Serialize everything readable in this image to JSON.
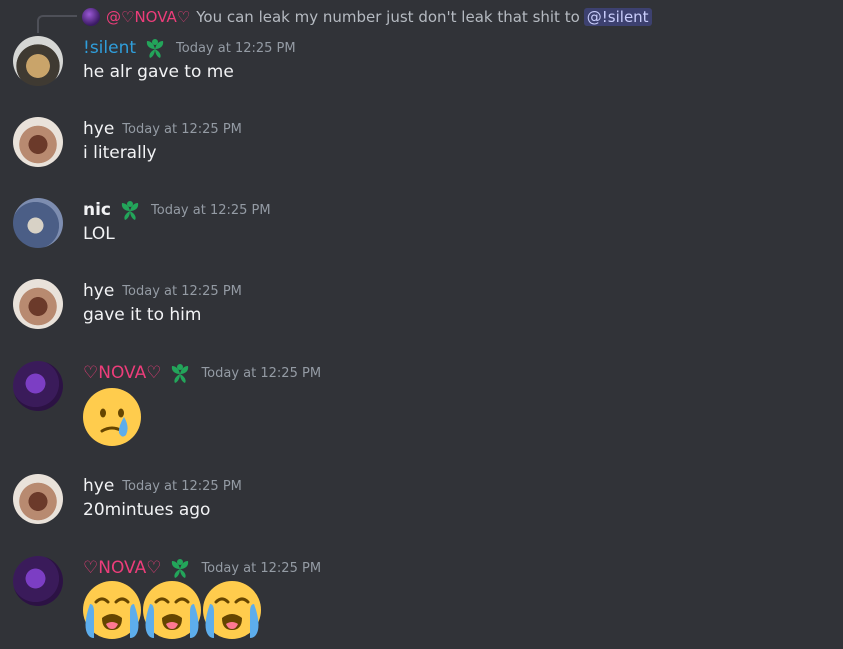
{
  "reply": {
    "author": "@♡NOVA♡",
    "text": "You can leak my number just don't leak that shit to",
    "mention": "@!silent"
  },
  "messages": [
    {
      "author": "!silent",
      "timestamp": "Today at 12:25 PM",
      "text": "he alr gave to me",
      "has_role_icon": true
    },
    {
      "author": "hye",
      "timestamp": "Today at 12:25 PM",
      "text": "i literally",
      "has_role_icon": false
    },
    {
      "author": "nic",
      "timestamp": "Today at 12:25 PM",
      "text": "LOL",
      "has_role_icon": true
    },
    {
      "author": "hye",
      "timestamp": "Today at 12:25 PM",
      "text": "gave it to him",
      "has_role_icon": false
    },
    {
      "author": "♡NOVA♡",
      "timestamp": "Today at 12:25 PM",
      "emojis": [
        "face-holding-back-tears"
      ],
      "has_role_icon": true
    },
    {
      "author": "hye",
      "timestamp": "Today at 12:25 PM",
      "text": "20mintues ago",
      "has_role_icon": false
    },
    {
      "author": "♡NOVA♡",
      "timestamp": "Today at 12:25 PM",
      "emojis": [
        "loudly-crying-face",
        "loudly-crying-face",
        "loudly-crying-face"
      ],
      "has_role_icon": true
    }
  ],
  "colors": {
    "background": "#313338",
    "silent_name": "#2f9edb",
    "nova_name": "#ec3d7a",
    "role_icon": "#23a55a",
    "timestamp": "#949ba4"
  }
}
